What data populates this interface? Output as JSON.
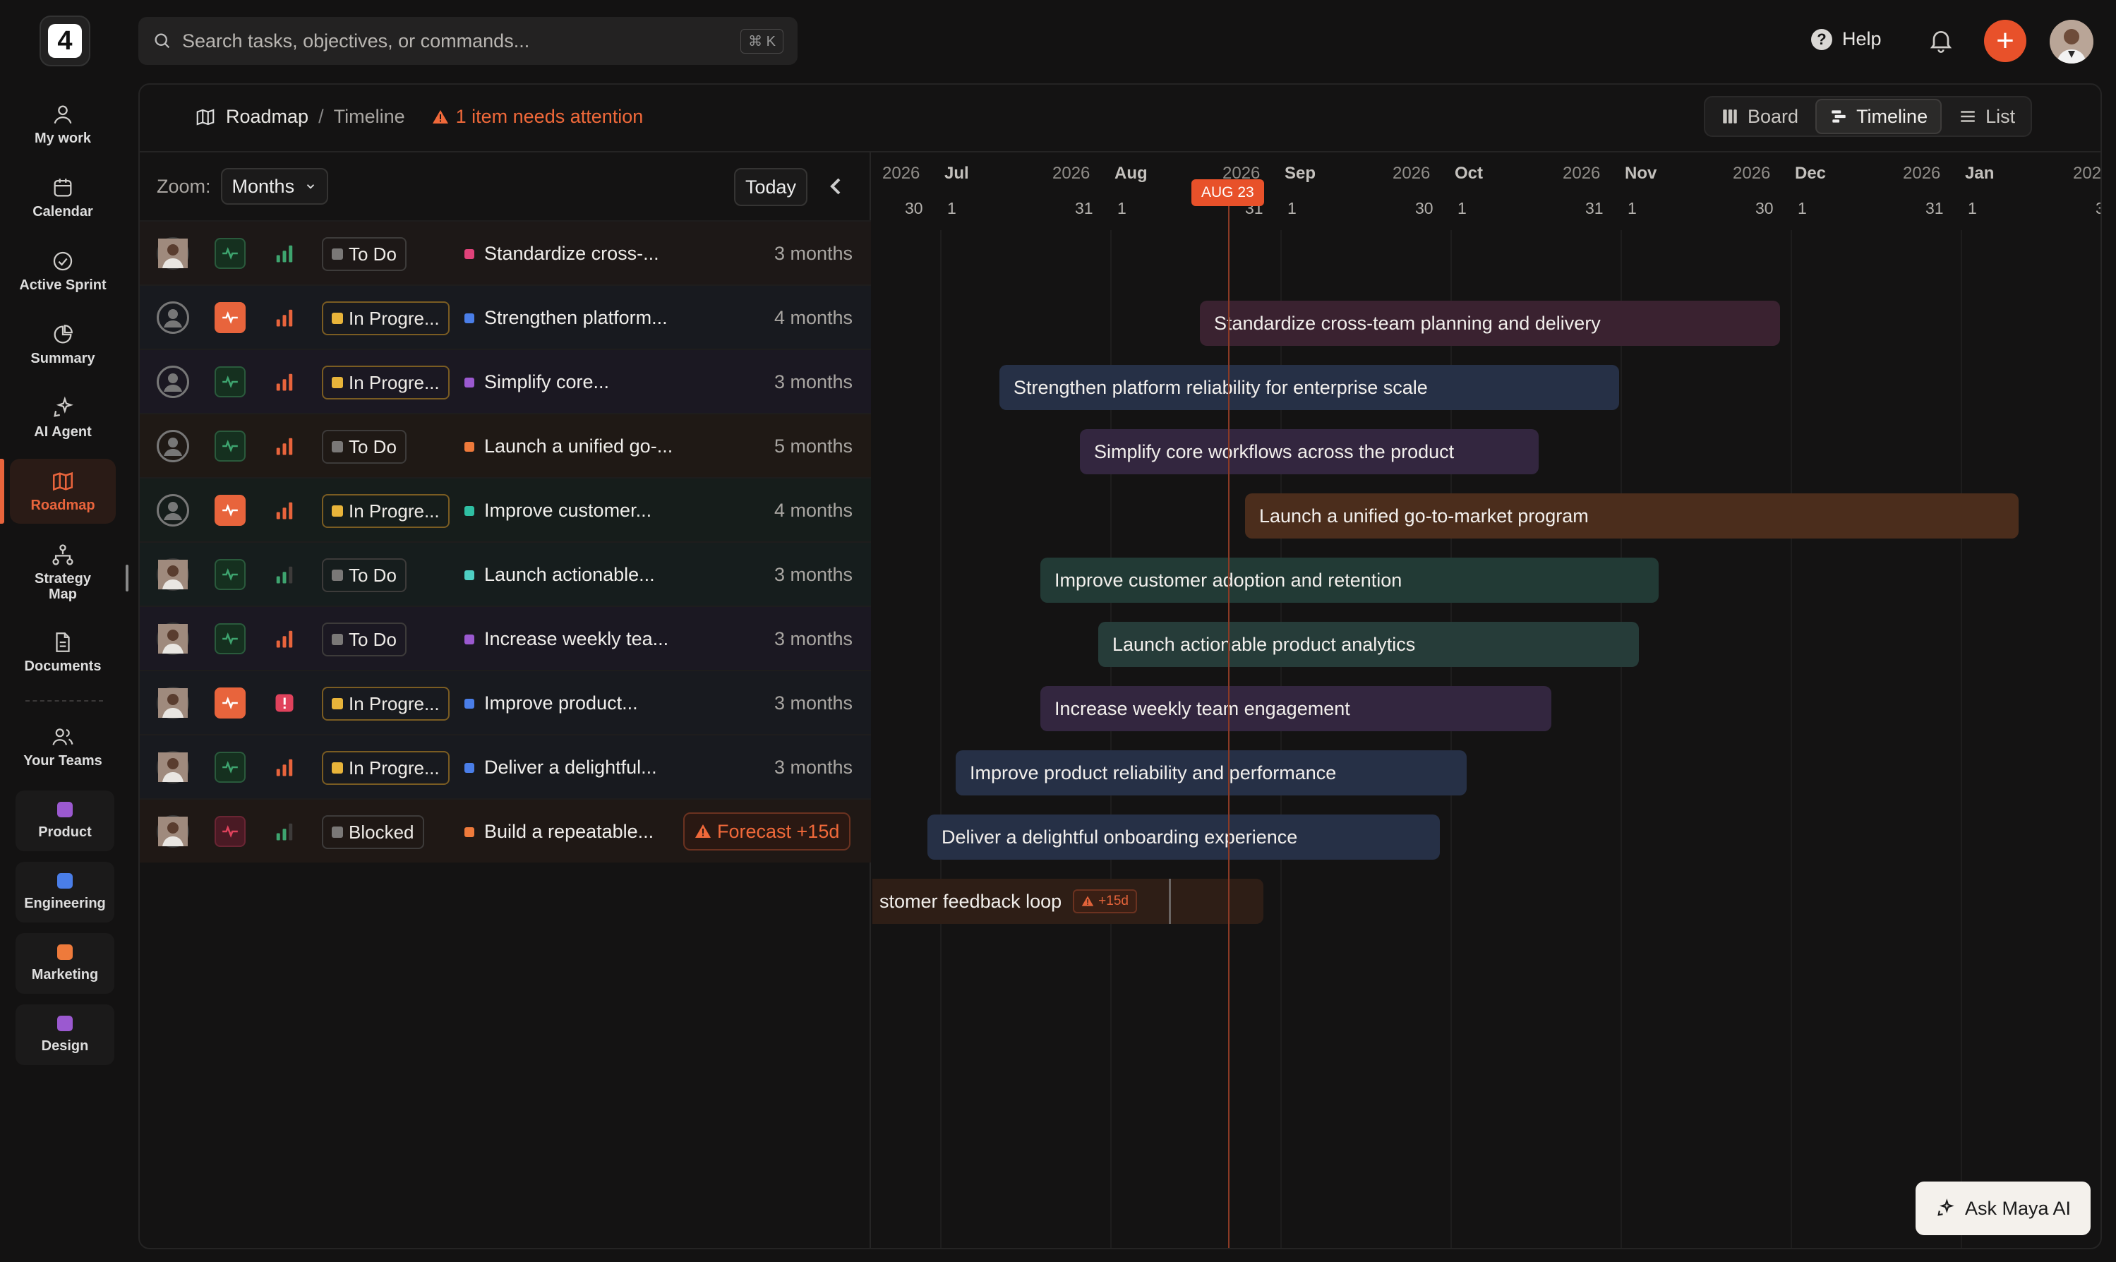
{
  "app": {
    "logo_text": "4"
  },
  "sidebar": {
    "items": [
      {
        "label": "My work",
        "icon": "person-icon"
      },
      {
        "label": "Calendar",
        "icon": "calendar-icon"
      },
      {
        "label": "Active Sprint",
        "icon": "check-circle-icon"
      },
      {
        "label": "Summary",
        "icon": "pie-chart-icon"
      },
      {
        "label": "AI Agent",
        "icon": "sparkle-icon"
      },
      {
        "label": "Roadmap",
        "icon": "map-icon",
        "active": true
      },
      {
        "label": "Strategy Map",
        "icon": "hierarchy-icon"
      },
      {
        "label": "Documents",
        "icon": "document-icon"
      },
      {
        "label": "Your Teams",
        "icon": "people-icon"
      }
    ],
    "teams": [
      {
        "label": "Product",
        "color": "#9b59d0"
      },
      {
        "label": "Engineering",
        "color": "#4a7ee8"
      },
      {
        "label": "Marketing",
        "color": "#ee7a3b"
      },
      {
        "label": "Design",
        "color": "#9b59d0"
      }
    ]
  },
  "topbar": {
    "search_placeholder": "Search tasks, objectives, or commands...",
    "search_shortcut": "⌘ K",
    "help_label": "Help"
  },
  "breadcrumb": {
    "root": "Roadmap",
    "separator": "/",
    "current": "Timeline",
    "attention": "1 item needs attention"
  },
  "views": {
    "board": "Board",
    "timeline": "Timeline",
    "list": "List",
    "active": "Timeline"
  },
  "toolbar": {
    "zoom_label": "Zoom:",
    "zoom_value": "Months",
    "today_label": "Today"
  },
  "colors": {
    "accent": "#e8512a",
    "todo": "#7a7877",
    "in_progress": "#e8b43a",
    "blocked": "#7a7877",
    "health_good": "#3ea46f",
    "health_warn": "#e8643c",
    "health_bad": "#e0425c"
  },
  "rows": [
    {
      "avatar": "photo",
      "health": "good",
      "priority": "medium",
      "status": "To Do",
      "status_type": "todo",
      "dot": "#e0427a",
      "name": "Standardize cross-...",
      "duration": "3 months"
    },
    {
      "avatar": "empty",
      "health": "warn",
      "priority": "high",
      "status": "In Progre...",
      "status_type": "in_progress",
      "dot": "#4a7ee8",
      "name": "Strengthen platform...",
      "duration": "4 months"
    },
    {
      "avatar": "empty",
      "health": "good",
      "priority": "high",
      "status": "In Progre...",
      "status_type": "in_progress",
      "dot": "#9b59d0",
      "name": "Simplify core...",
      "duration": "3 months"
    },
    {
      "avatar": "empty",
      "health": "good",
      "priority": "high",
      "status": "To Do",
      "status_type": "todo",
      "dot": "#ee7a3b",
      "name": "Launch a unified go-...",
      "duration": "5 months"
    },
    {
      "avatar": "empty",
      "health": "warn",
      "priority": "high",
      "status": "In Progre...",
      "status_type": "in_progress",
      "dot": "#2fbfa3",
      "name": "Improve customer...",
      "duration": "4 months"
    },
    {
      "avatar": "photo",
      "health": "good",
      "priority": "low",
      "status": "To Do",
      "status_type": "todo",
      "dot": "#4ecfc3",
      "name": "Launch actionable...",
      "duration": "3 months"
    },
    {
      "avatar": "photo",
      "health": "good",
      "priority": "high",
      "status": "To Do",
      "status_type": "todo",
      "dot": "#9b59d0",
      "name": "Increase weekly tea...",
      "duration": "3 months"
    },
    {
      "avatar": "photo",
      "health": "warn",
      "priority": "urgent",
      "status": "In Progre...",
      "status_type": "in_progress",
      "dot": "#4a7ee8",
      "name": "Improve product...",
      "duration": "3 months"
    },
    {
      "avatar": "photo",
      "health": "good",
      "priority": "high",
      "status": "In Progre...",
      "status_type": "in_progress",
      "dot": "#4a7ee8",
      "name": "Deliver a delightful...",
      "duration": "3 months"
    },
    {
      "avatar": "photo",
      "health": "bad",
      "priority": "low",
      "status": "Blocked",
      "status_type": "blocked",
      "dot": "#ee7a3b",
      "name": "Build a repeatable...",
      "duration": "",
      "forecast": "Forecast +15d"
    }
  ],
  "timeline": {
    "today_badge": "AUG 23",
    "months": [
      {
        "year": "2026",
        "month": "Jul",
        "prev_last_day": "30",
        "first_day": "1"
      },
      {
        "year": "2026",
        "month": "Aug",
        "prev_last_day": "31",
        "first_day": "1"
      },
      {
        "year": "2026",
        "month": "Sep",
        "prev_last_day": "31",
        "first_day": "1"
      },
      {
        "year": "2026",
        "month": "Oct",
        "prev_last_day": "30",
        "first_day": "1"
      },
      {
        "year": "2026",
        "month": "Nov",
        "prev_last_day": "31",
        "first_day": "1"
      },
      {
        "year": "2026",
        "month": "Dec",
        "prev_last_day": "30",
        "first_day": "1"
      },
      {
        "year": "2026",
        "month": "Jan",
        "prev_last_day": "31",
        "first_day": "1"
      },
      {
        "year": "202",
        "month": "",
        "prev_last_day": "3",
        "first_day": ""
      }
    ],
    "bars": [
      {
        "label": "Standardize cross-team planning and delivery",
        "color": "#3a2230"
      },
      {
        "label": "Strengthen platform reliability for enterprise scale",
        "color": "#263046"
      },
      {
        "label": "Simplify core workflows across the product",
        "color": "#33263f"
      },
      {
        "label": "Launch a unified go-to-market program",
        "color": "#4b2d1c"
      },
      {
        "label": "Improve customer adoption and retention",
        "color": "#223a35"
      },
      {
        "label": "Launch actionable product analytics",
        "color": "#263c39"
      },
      {
        "label": "Increase weekly team engagement",
        "color": "#33263f"
      },
      {
        "label": "Improve product reliability and performance",
        "color": "#263046"
      },
      {
        "label": "Deliver a delightful onboarding experience",
        "color": "#263046"
      },
      {
        "label": "stomer feedback loop",
        "color": "#2e1e16",
        "flag": "+15d"
      }
    ]
  },
  "ask_maya": "Ask Maya AI"
}
